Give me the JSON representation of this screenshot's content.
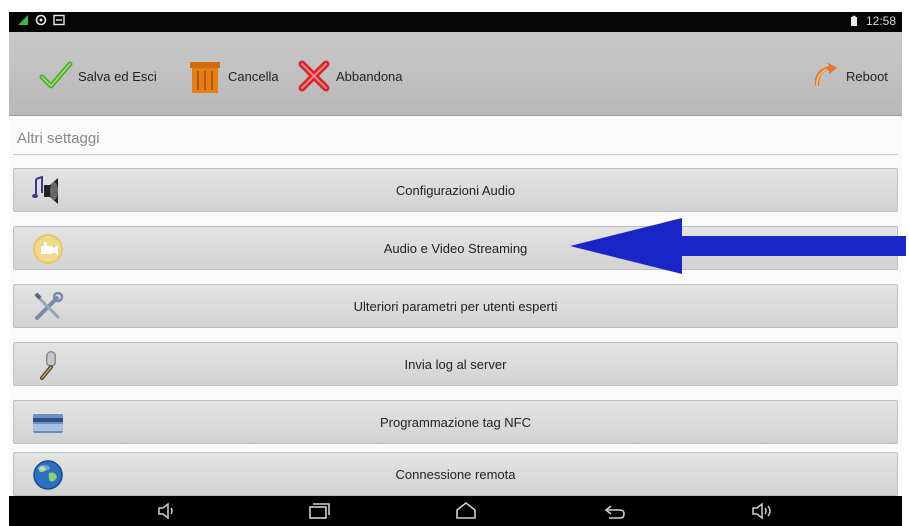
{
  "statusbar": {
    "time": "12:58",
    "left_icons": [
      "signal-icon",
      "location-icon",
      "photo-icon"
    ],
    "right_icons": [
      "battery-icon"
    ]
  },
  "toolbar": {
    "save_label": "Salva ed Esci",
    "delete_label": "Cancella",
    "abandon_label": "Abbandona",
    "reboot_label": "Reboot"
  },
  "section": {
    "title": "Altri settaggi"
  },
  "rows": [
    {
      "label": "Configurazioni Audio",
      "icon": "speaker-music-icon"
    },
    {
      "label": "Audio e Video Streaming",
      "icon": "video-stream-icon"
    },
    {
      "label": "Ulteriori parametri per utenti esperti",
      "icon": "tools-icon"
    },
    {
      "label": "Invia log al server",
      "icon": "microphone-icon"
    },
    {
      "label": "Programmazione tag NFC",
      "icon": "nfc-card-icon"
    },
    {
      "label": "Connessione remota",
      "icon": "globe-icon"
    }
  ],
  "navbar": {
    "icons": [
      "volume-down-icon",
      "recent-apps-icon",
      "home-icon",
      "back-icon",
      "volume-up-icon"
    ]
  },
  "colors": {
    "arrow": "#1a25c8",
    "save_check": "#4caf2a",
    "delete_bin": "#e67e12",
    "abandon_x": "#d4262a",
    "reboot": "#e07a2a"
  }
}
